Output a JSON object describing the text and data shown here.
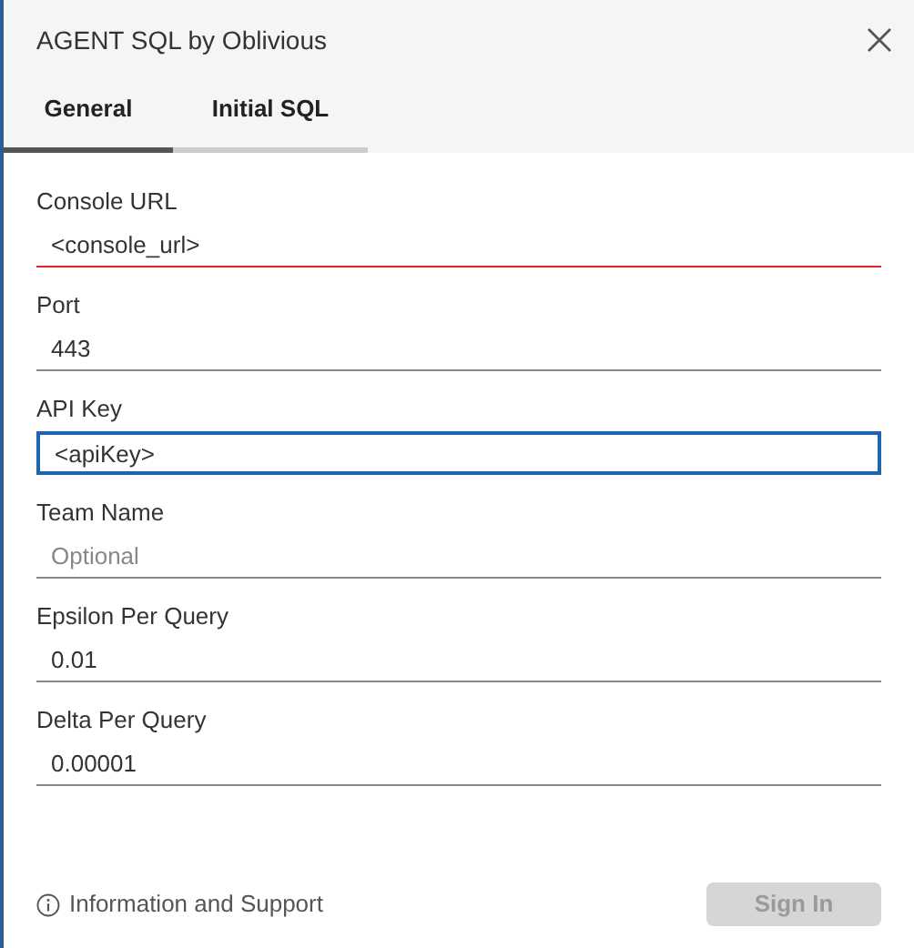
{
  "window": {
    "title": "AGENT SQL by Oblivious"
  },
  "tabs": [
    {
      "label": "General",
      "selected": true
    },
    {
      "label": "Initial SQL",
      "selected": false
    }
  ],
  "fields": [
    {
      "label": "Console URL",
      "value": "<console_url>",
      "invalid": true,
      "focused": false
    },
    {
      "label": "Port",
      "value": "443",
      "invalid": false,
      "focused": false
    },
    {
      "label": "API Key",
      "value": "<apiKey>",
      "invalid": false,
      "focused": true
    },
    {
      "label": "Team Name",
      "placeholder": "Optional",
      "invalid": false,
      "focused": false
    },
    {
      "label": "Epsilon Per Query",
      "value": "0.01",
      "invalid": false,
      "focused": false
    },
    {
      "label": "Delta Per Query",
      "value": "0.00001",
      "invalid": false,
      "focused": false
    }
  ],
  "footer": {
    "link": "Information and Support",
    "button": {
      "label": "Sign In",
      "disabled": true
    }
  }
}
